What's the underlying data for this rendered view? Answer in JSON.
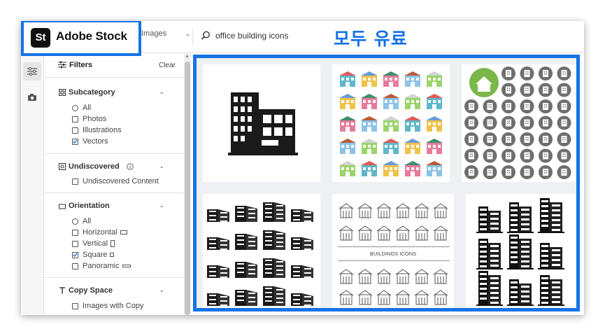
{
  "header": {
    "logo_mark": "St",
    "logo_text": "Adobe Stock",
    "content_type": "Images",
    "search_query": "office building icons",
    "promo_text": "모두 유료"
  },
  "rail": {
    "icons": [
      "filters-icon",
      "camera-icon"
    ]
  },
  "filters": {
    "title": "Filters",
    "clear_label": "Clear",
    "sections": {
      "subcategory": {
        "title": "Subcategory",
        "options": [
          "All",
          "Photos",
          "Illustrations",
          "Vectors"
        ],
        "selected": "Vectors"
      },
      "undiscovered": {
        "title": "Undiscovered",
        "options": [
          "Undiscovered Content"
        ]
      },
      "orientation": {
        "title": "Orientation",
        "options": [
          "All",
          "Horizontal",
          "Vertical",
          "Square",
          "Panoramic"
        ],
        "selected": "Square"
      },
      "copy_space": {
        "title": "Copy Space",
        "options": [
          "Images with Copy"
        ]
      }
    }
  },
  "results": {
    "items": [
      {
        "name": "office-building-icon",
        "style": "single black building"
      },
      {
        "name": "colorful-buildings-set",
        "style": "flat color building icons"
      },
      {
        "name": "gray-circle-building-icons",
        "style": "gray circular icons"
      },
      {
        "name": "black-3d-buildings-set",
        "style": "black perspective buildings"
      },
      {
        "name": "line-buildings-icons",
        "style": "outline building icons",
        "caption": "BUILDINGS ICONS"
      },
      {
        "name": "black-skyscrapers-set",
        "style": "black skyscraper icons"
      }
    ]
  },
  "colors": {
    "accent_blue": "#1473e6",
    "text": "#333333",
    "icon_green": "#7ab648"
  }
}
